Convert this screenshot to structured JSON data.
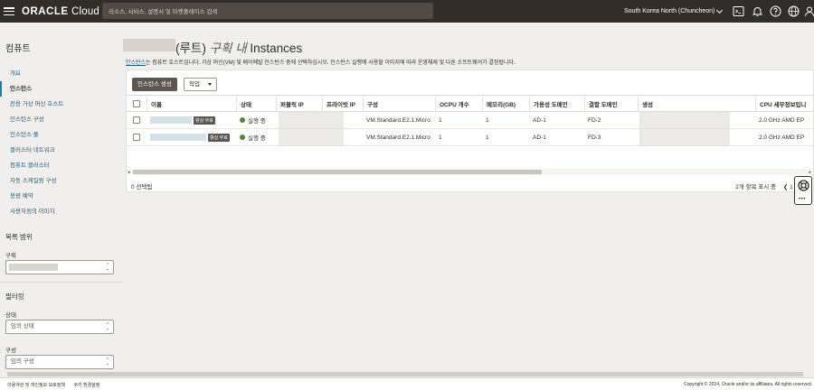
{
  "topbar": {
    "brand_main": "ORACLE",
    "brand_sub": "Cloud",
    "search_placeholder": "리소스, 서비스, 설명서 및 마켓플레이스 검색",
    "region": "South Korea North (Chuncheon)"
  },
  "sidebar": {
    "title": "컴퓨트",
    "items": [
      {
        "label": "개요"
      },
      {
        "label": "인스턴스"
      },
      {
        "label": "전용 가상 머신 호스트"
      },
      {
        "label": "인스턴스 구성"
      },
      {
        "label": "인스턴스 풀"
      },
      {
        "label": "클러스터 네트워크"
      },
      {
        "label": "컴퓨트 클러스터"
      },
      {
        "label": "자동 스케일링 구성"
      },
      {
        "label": "용량 예약"
      },
      {
        "label": "사용자정의 이미지"
      }
    ],
    "list_scope": {
      "heading": "목록 범위",
      "compartment_label": "구획"
    },
    "filtering": {
      "heading": "필터링",
      "state_label": "상태",
      "state_value": "임의 상태",
      "shape_label": "구성",
      "shape_value": "임의 구성"
    }
  },
  "main": {
    "title_part1": "(루트)",
    "title_part2": "구획 내",
    "title_part3": "Instances",
    "desc_link": "인스턴스",
    "desc_rest": "는 컴퓨트 호스트입니다. 가상 머신(VM) 및 베어메탈 인스턴스 중에 선택하십시오. 인스턴스 실행에 사용할 이미지에 따라 운영체제 및 다른 소프트웨어가 결정됩니다.",
    "create_button": "인스턴스 생성",
    "actions_button": "작업",
    "columns": [
      "이름",
      "상태",
      "퍼블릭 IP",
      "프라이빗 IP",
      "구성",
      "OCPU 개수",
      "메모리(GB)",
      "가용성 도메인",
      "결함 도메인",
      "생성",
      "CPU 세부정보입니"
    ],
    "rows": [
      {
        "badge": "항상 무료",
        "state": "실행 중",
        "shape": "VM.Standard.E2.1.Micro",
        "ocpu": "1",
        "memory": "1",
        "ad": "AD-1",
        "fd": "FD-2",
        "cpu": "2.0 GHz AMD EP"
      },
      {
        "badge": "항상 무료",
        "state": "실행 중",
        "shape": "VM.Standard.E2.1.Micro",
        "ocpu": "1",
        "memory": "1",
        "ad": "AD-1",
        "fd": "FD-3",
        "cpu": "2.0 GHz AMD EP"
      }
    ],
    "selected_count": "0 선택됨",
    "pager_text": "2개 항목 표시 중",
    "page_info": "1 / 1"
  },
  "footer": {
    "terms": "이용약관 및 개인정보 보호정책",
    "cookies": "쿠키 환경설정",
    "copyright": "Copyright © 2024, Oracle and/or its affiliates. All rights reserved."
  },
  "colors": {
    "topbar_bg": "#312d2a",
    "link": "#1f5c7d",
    "running_green": "#4a8a32",
    "primary_button": "#5b5651"
  }
}
